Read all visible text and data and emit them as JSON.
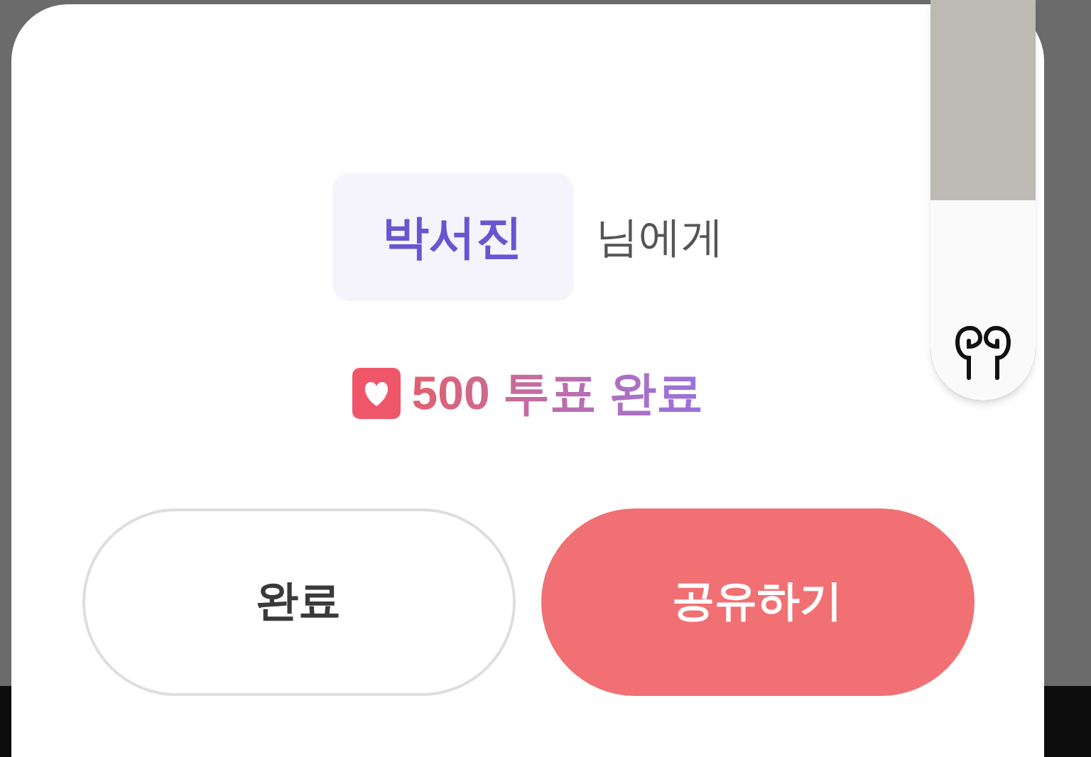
{
  "dialog": {
    "recipient": "박서진",
    "recipient_suffix": "님에게",
    "vote_result": "500 투표 완료",
    "buttons": [
      {
        "label": "완료",
        "kind": "secondary"
      },
      {
        "label": "공유하기",
        "kind": "primary"
      }
    ]
  },
  "volume_panel": {
    "level": 0.5
  }
}
